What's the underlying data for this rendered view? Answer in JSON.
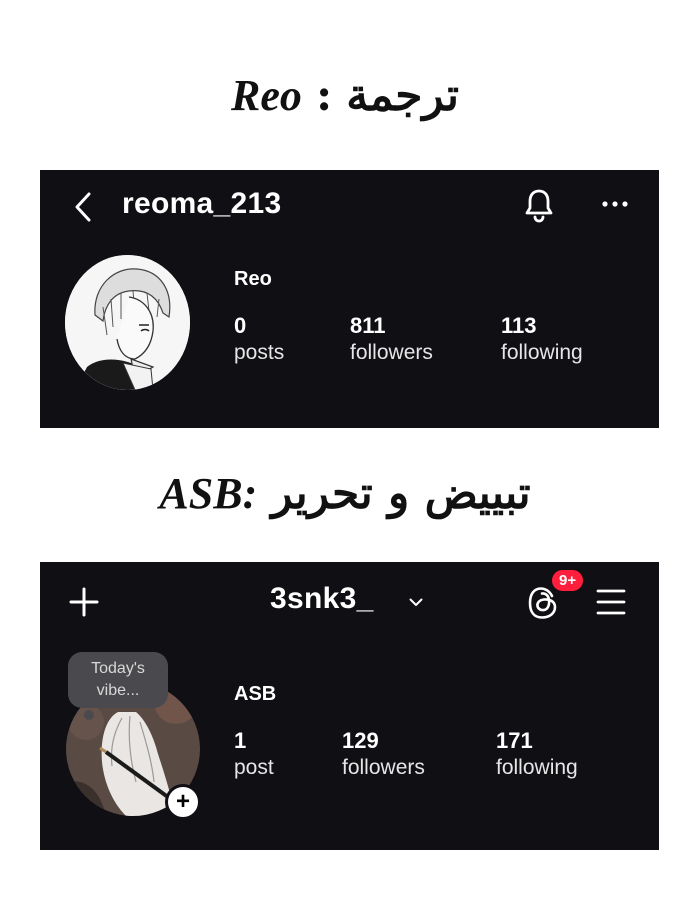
{
  "heading1": {
    "arabic": "ترجمة",
    "sep": ":",
    "latin": "Reo"
  },
  "heading2": {
    "arabic": "تبييض و تحرير",
    "latin": "ASB:"
  },
  "profile1": {
    "username": "reoma_213",
    "display_name": "Reo",
    "stats": [
      {
        "value": "0",
        "label": "posts"
      },
      {
        "value": "811",
        "label": "followers"
      },
      {
        "value": "113",
        "label": "following"
      }
    ],
    "icons": {
      "back": "back-chevron-icon",
      "bell": "bell-icon",
      "more": "more-icon"
    }
  },
  "profile2": {
    "username": "3snk3_",
    "display_name": "ASB",
    "note": "Today's vibe...",
    "notification_badge": "9+",
    "stats": [
      {
        "value": "1",
        "label": "post"
      },
      {
        "value": "129",
        "label": "followers"
      },
      {
        "value": "171",
        "label": "following"
      }
    ],
    "icons": {
      "add": "plus-icon",
      "chevron": "chevron-down-icon",
      "threads": "threads-icon",
      "menu": "hamburger-menu-icon"
    }
  },
  "colors": {
    "card_bg": "#0f0f14",
    "badge": "#ff1f3d",
    "text": "#ffffff"
  }
}
